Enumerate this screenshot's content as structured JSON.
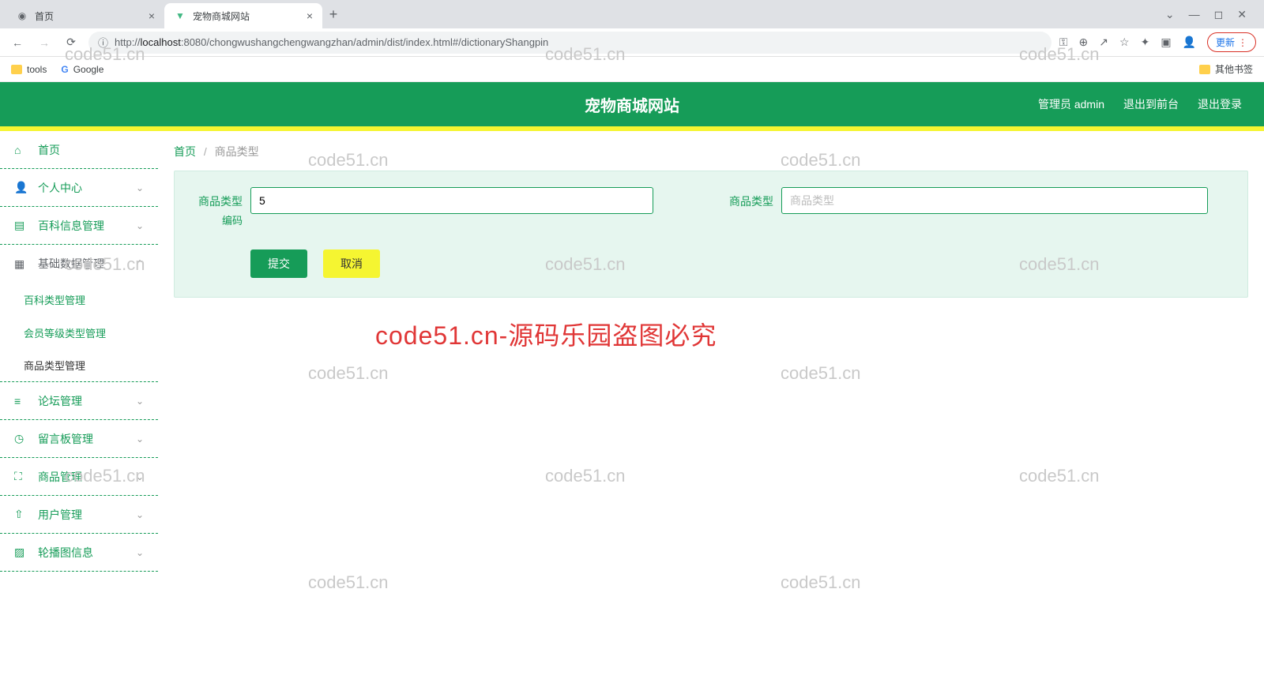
{
  "browser": {
    "tabs": [
      {
        "title": "首页",
        "active": false
      },
      {
        "title": "宠物商城网站",
        "active": true
      }
    ],
    "url_prefix": "http://",
    "url_host": "localhost",
    "url_rest": ":8080/chongwushangchengwangzhan/admin/dist/index.html#/dictionaryShangpin",
    "update_label": "更新",
    "bookmarks": {
      "tools": "tools",
      "google": "Google",
      "other": "其他书签"
    }
  },
  "header": {
    "title": "宠物商城网站",
    "user": "管理员 admin",
    "to_front": "退出到前台",
    "logout": "退出登录"
  },
  "sidebar": {
    "home": "首页",
    "personal": "个人中心",
    "baike": "百科信息管理",
    "basic": "基础数据管理",
    "sub_baike_type": "百科类型管理",
    "sub_member_level": "会员等级类型管理",
    "sub_goods_type": "商品类型管理",
    "forum": "论坛管理",
    "guestbook": "留言板管理",
    "goods": "商品管理",
    "users": "用户管理",
    "carousel": "轮播图信息"
  },
  "breadcrumb": {
    "home": "首页",
    "current": "商品类型"
  },
  "form": {
    "label_code": "商品类型编码",
    "label_code_line1": "商品类型",
    "label_code_line2": "编码",
    "label_type": "商品类型",
    "code_value": "5",
    "type_placeholder": "商品类型",
    "submit": "提交",
    "cancel": "取消"
  },
  "watermarks": {
    "text": "code51.cn",
    "red": "code51.cn-源码乐园盗图必究"
  }
}
